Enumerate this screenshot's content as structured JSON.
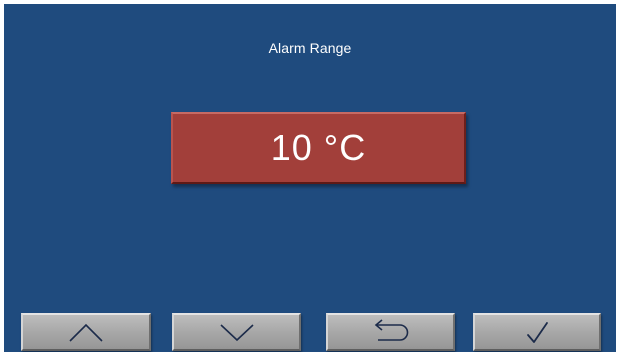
{
  "screen": {
    "title": "Alarm Range",
    "value": "10 °C",
    "accent_color": "#a23f3a",
    "background_color": "#1f4b7e"
  },
  "buttons": [
    {
      "icon": "chevron-up-icon"
    },
    {
      "icon": "chevron-down-icon"
    },
    {
      "icon": "return-arrow-icon"
    },
    {
      "icon": "checkmark-icon"
    }
  ]
}
